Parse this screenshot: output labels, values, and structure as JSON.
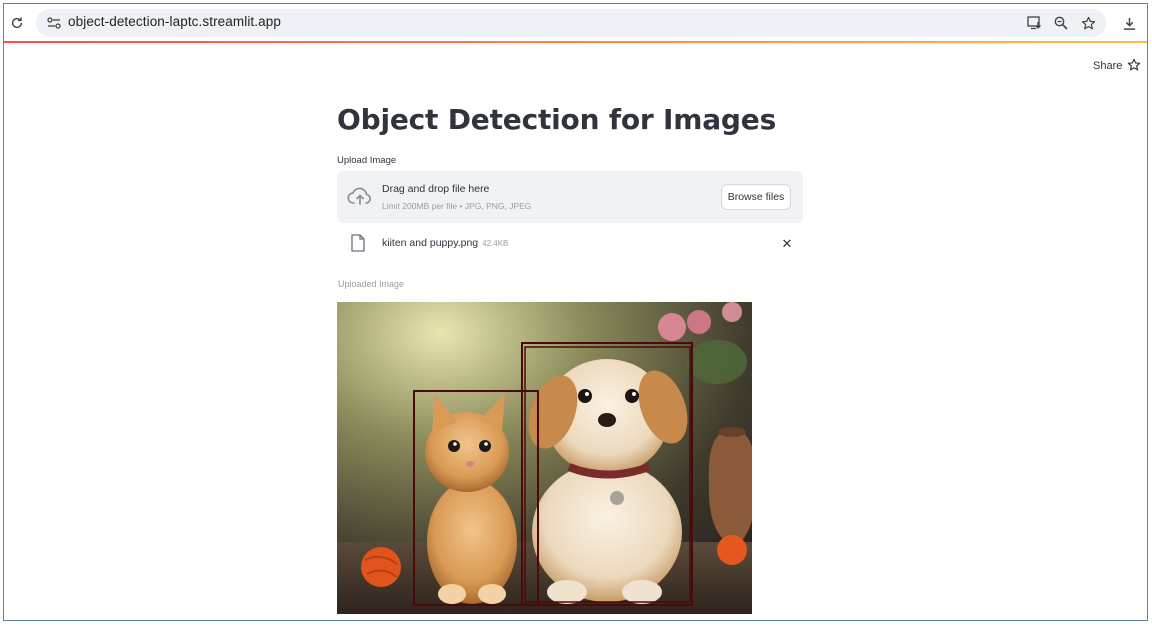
{
  "browser": {
    "url": "object-detection-laptc.streamlit.app"
  },
  "header": {
    "share_label": "Share"
  },
  "main": {
    "title": "Object Detection for Images",
    "upload_label": "Upload Image",
    "dropzone": {
      "title": "Drag and drop file here",
      "subtitle": "Limit 200MB per file • JPG, PNG, JPEG",
      "browse_label": "Browse files"
    },
    "file": {
      "name": "kiiten and puppy.png",
      "size": "42.4KB",
      "remove_symbol": "✕"
    },
    "image_caption": "Uploaded Image"
  },
  "colors": {
    "accent_gradient_start": "#ff4b4b",
    "accent_gradient_end": "#ffbd45",
    "bbox_color": "#4a0a0a",
    "text": "#31333f"
  }
}
